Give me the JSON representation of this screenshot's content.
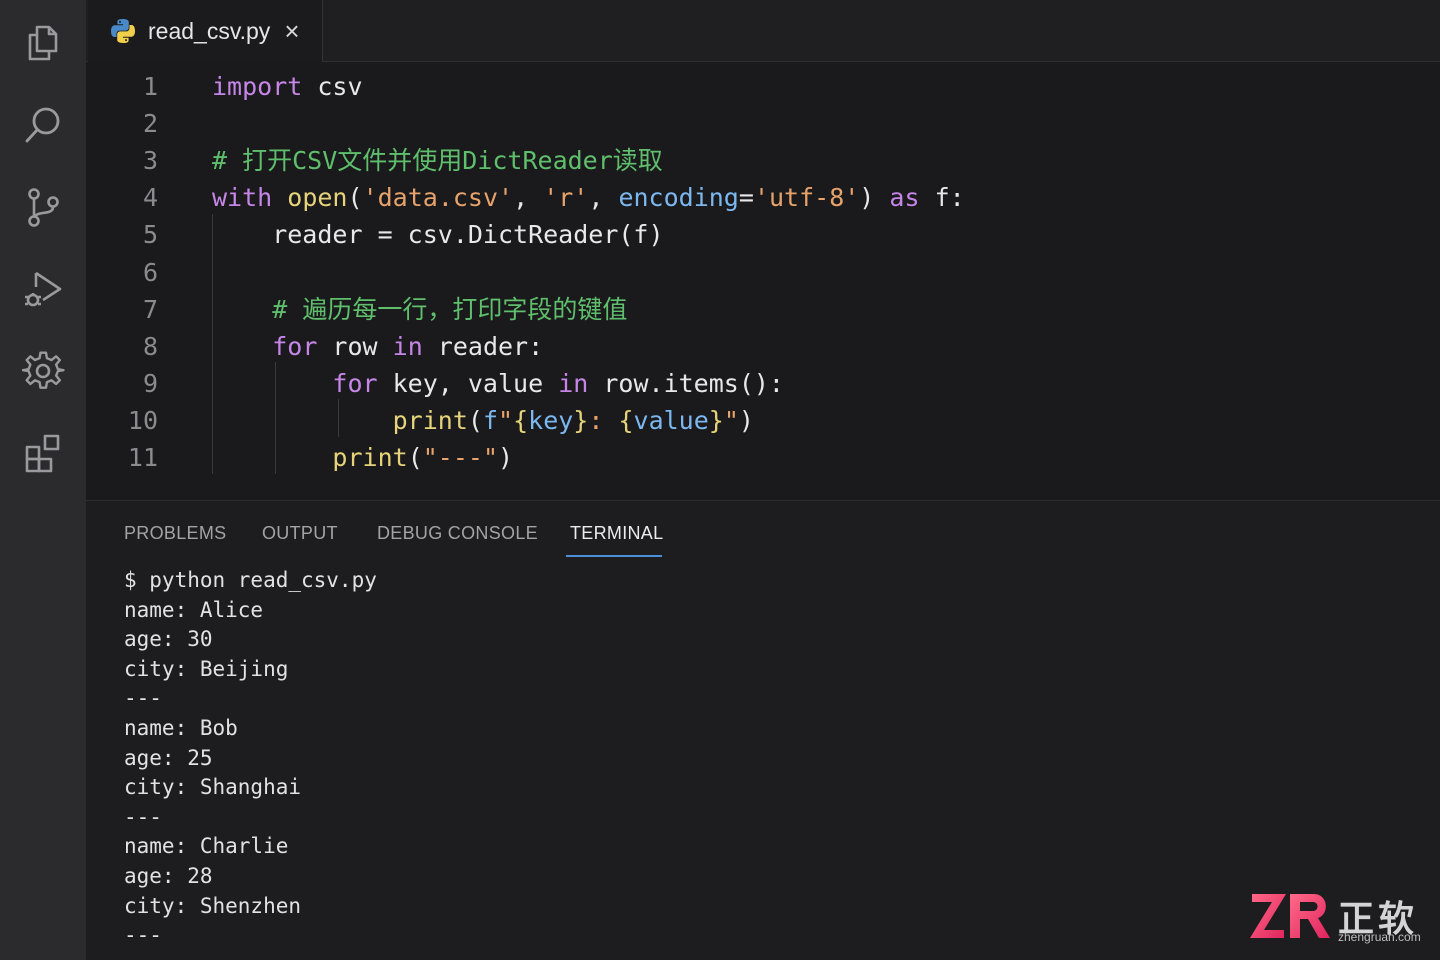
{
  "tab": {
    "filename": "read_csv.py",
    "close_glyph": "×",
    "icon": "python-icon"
  },
  "activity_bar": {
    "icons": [
      "files-icon",
      "search-icon",
      "source-control-icon",
      "run-debug-icon",
      "settings-gear-icon",
      "extensions-icon"
    ]
  },
  "editor": {
    "line_numbers": [
      "1",
      "2",
      "3",
      "4",
      "5",
      "6",
      "7",
      "8",
      "9",
      "10",
      "11"
    ],
    "lines": [
      [
        {
          "t": "import",
          "c": "kw"
        },
        {
          "t": " csv",
          "c": "plain"
        }
      ],
      [],
      [
        {
          "t": "# 打开CSV文件并使用DictReader读取",
          "c": "cm"
        }
      ],
      [
        {
          "t": "with",
          "c": "kw"
        },
        {
          "t": " ",
          "c": "plain"
        },
        {
          "t": "open",
          "c": "fn"
        },
        {
          "t": "(",
          "c": "plain"
        },
        {
          "t": "'data.csv'",
          "c": "str"
        },
        {
          "t": ", ",
          "c": "plain"
        },
        {
          "t": "'r'",
          "c": "str"
        },
        {
          "t": ", ",
          "c": "plain"
        },
        {
          "t": "encoding",
          "c": "param"
        },
        {
          "t": "=",
          "c": "plain"
        },
        {
          "t": "'utf-8'",
          "c": "str"
        },
        {
          "t": ") ",
          "c": "plain"
        },
        {
          "t": "as",
          "c": "kw"
        },
        {
          "t": " f:",
          "c": "plain"
        }
      ],
      [
        {
          "t": "    reader = csv.DictReader(f)",
          "c": "plain"
        }
      ],
      [],
      [
        {
          "t": "    ",
          "c": "plain"
        },
        {
          "t": "# 遍历每一行，打印字段的键值",
          "c": "cm"
        }
      ],
      [
        {
          "t": "    ",
          "c": "plain"
        },
        {
          "t": "for",
          "c": "kw"
        },
        {
          "t": " row ",
          "c": "plain"
        },
        {
          "t": "in",
          "c": "kw"
        },
        {
          "t": " reader:",
          "c": "plain"
        }
      ],
      [
        {
          "t": "        ",
          "c": "plain"
        },
        {
          "t": "for",
          "c": "kw"
        },
        {
          "t": " key, value ",
          "c": "plain"
        },
        {
          "t": "in",
          "c": "kw"
        },
        {
          "t": " row.items():",
          "c": "plain"
        }
      ],
      [
        {
          "t": "            ",
          "c": "plain"
        },
        {
          "t": "print",
          "c": "fn"
        },
        {
          "t": "(",
          "c": "plain"
        },
        {
          "t": "f",
          "c": "param"
        },
        {
          "t": "\"",
          "c": "str"
        },
        {
          "t": "{",
          "c": "brace"
        },
        {
          "t": "key",
          "c": "param"
        },
        {
          "t": "}",
          "c": "brace"
        },
        {
          "t": ": ",
          "c": "str"
        },
        {
          "t": "{",
          "c": "brace"
        },
        {
          "t": "value",
          "c": "param"
        },
        {
          "t": "}",
          "c": "brace"
        },
        {
          "t": "\"",
          "c": "str"
        },
        {
          "t": ")",
          "c": "plain"
        }
      ],
      [
        {
          "t": "        ",
          "c": "plain"
        },
        {
          "t": "print",
          "c": "fn"
        },
        {
          "t": "(",
          "c": "plain"
        },
        {
          "t": "\"---\"",
          "c": "str"
        },
        {
          "t": ")",
          "c": "plain"
        }
      ]
    ]
  },
  "panel": {
    "tabs": [
      "PROBLEMS",
      "OUTPUT",
      "DEBUG CONSOLE",
      "TERMINAL"
    ],
    "active_tab": "TERMINAL",
    "terminal_lines": [
      "$ python read_csv.py",
      "name: Alice",
      "age: 30",
      "city: Beijing",
      "---",
      "name: Bob",
      "age: 25",
      "city: Shanghai",
      "---",
      "name: Charlie",
      "age: 28",
      "city: Shenzhen",
      "---"
    ]
  },
  "watermark": {
    "logo": "ZR",
    "brand": "正软",
    "url": "zhengruan.com"
  }
}
